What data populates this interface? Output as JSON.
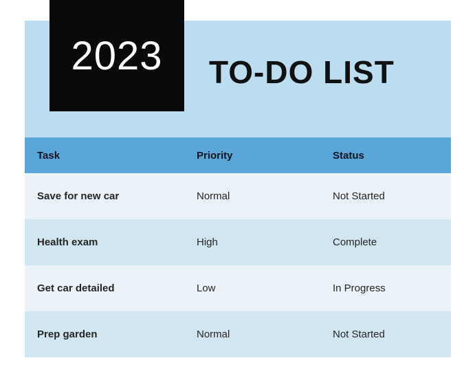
{
  "header": {
    "year": "2023",
    "title": "TO-DO LIST"
  },
  "table": {
    "columns": {
      "task": "Task",
      "priority": "Priority",
      "status": "Status"
    },
    "rows": [
      {
        "task": "Save for new car",
        "priority": "Normal",
        "status": "Not Started"
      },
      {
        "task": "Health exam",
        "priority": "High",
        "status": "Complete"
      },
      {
        "task": "Get car detailed",
        "priority": "Low",
        "status": "In Progress"
      },
      {
        "task": "Prep garden",
        "priority": "Normal",
        "status": "Not Started"
      }
    ]
  }
}
